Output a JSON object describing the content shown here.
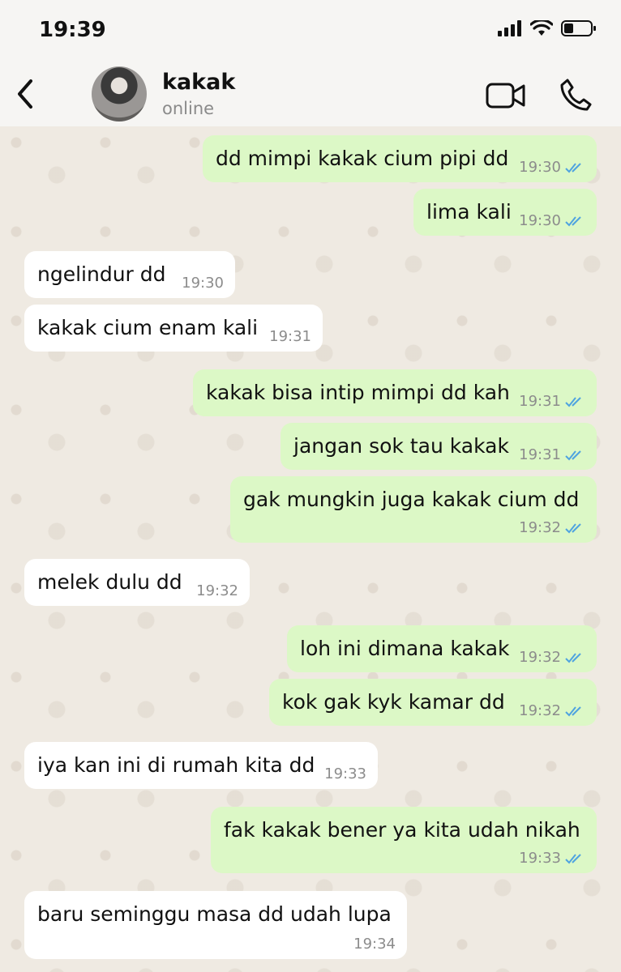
{
  "status": {
    "time": "19:39"
  },
  "contact": {
    "name": "kakak",
    "presence": "online"
  },
  "messages": [
    {
      "dir": "out",
      "text": "dd mimpi kakak cium pipi dd",
      "time": "19:30"
    },
    {
      "dir": "out",
      "text": "lima kali",
      "time": "19:30"
    },
    {
      "dir": "in",
      "text": "ngelindur dd",
      "time": "19:30"
    },
    {
      "dir": "in",
      "text": "kakak cium enam kali",
      "time": "19:31"
    },
    {
      "dir": "out",
      "text": "kakak bisa intip mimpi dd kah",
      "time": "19:31"
    },
    {
      "dir": "out",
      "text": "jangan sok tau kakak",
      "time": "19:31"
    },
    {
      "dir": "out",
      "text": "gak mungkin juga kakak cium dd",
      "time": "19:32"
    },
    {
      "dir": "in",
      "text": "melek dulu dd",
      "time": "19:32"
    },
    {
      "dir": "out",
      "text": "loh ini dimana kakak",
      "time": "19:32"
    },
    {
      "dir": "out",
      "text": "kok gak kyk kamar dd",
      "time": "19:32"
    },
    {
      "dir": "in",
      "text": "iya kan ini di rumah kita dd",
      "time": "19:33"
    },
    {
      "dir": "out",
      "text": "fak kakak bener ya kita udah nikah",
      "time": "19:33"
    },
    {
      "dir": "in",
      "text": "baru seminggu masa dd udah lupa",
      "time": "19:34"
    }
  ],
  "colors": {
    "outgoing": "#dcf8c6",
    "incoming": "#ffffff",
    "read_ticks": "#4fa3e0"
  },
  "icons": [
    "signal-icon",
    "wifi-icon",
    "battery-icon",
    "back-chevron-icon",
    "video-call-icon",
    "phone-call-icon",
    "read-ticks-icon"
  ]
}
